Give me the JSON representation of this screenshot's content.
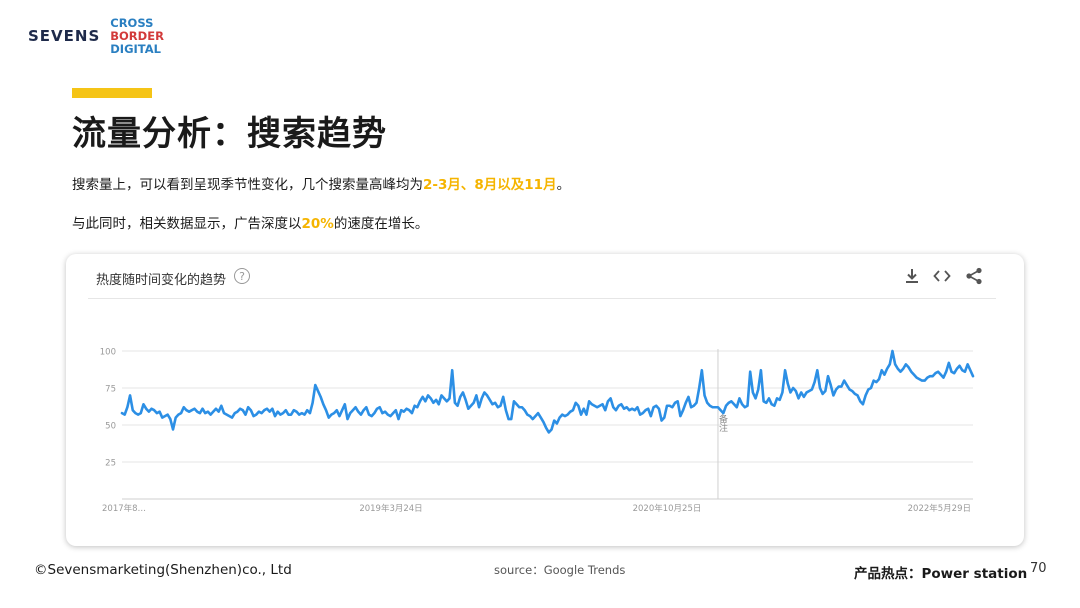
{
  "logo": {
    "brand": "SEVENS",
    "lines": [
      "CROSS",
      "BORDER",
      "DIGITAL"
    ]
  },
  "title": "流量分析：搜索趋势",
  "paragraph1": {
    "before": "搜索量上，可以看到呈现季节性变化，几个搜索量高峰均为",
    "highlight": "2-3月、8月以及11月",
    "after": "。"
  },
  "paragraph2": {
    "before": "与此同时，相关数据显示，广告深度以",
    "highlight": "20%",
    "after": "的速度在增长。"
  },
  "card": {
    "title": "热度随时间变化的趋势",
    "help": "?",
    "tools": [
      "download-icon",
      "embed-icon",
      "share-icon"
    ]
  },
  "footer": {
    "copyright": "©Sevensmarketing(Shenzhen)co., Ltd",
    "source": "source：Google Trends",
    "product": "产品热点：Power station",
    "page": "70"
  },
  "colors": {
    "accent": "#f5c416",
    "highlight": "#f5b400",
    "line": "#2c8fe5"
  },
  "chart_data": {
    "type": "line",
    "title": "",
    "xlabel": "",
    "ylabel": "",
    "ylim": [
      0,
      100
    ],
    "yticks": [
      25,
      50,
      75,
      100
    ],
    "xticks": [
      "2017年8…",
      "2019年3月24日",
      "2020年10月25日",
      "2022年5月29日"
    ],
    "annotation": "备注",
    "annotation_index": 222,
    "grid": true,
    "series": [
      {
        "values": [
          58,
          57,
          62,
          70,
          60,
          58,
          57,
          58,
          64,
          61,
          59,
          61,
          60,
          58,
          59,
          55,
          56,
          57,
          54,
          47,
          55,
          57,
          58,
          62,
          60,
          59,
          60,
          61,
          59,
          58,
          61,
          58,
          59,
          57,
          59,
          61,
          59,
          63,
          58,
          57,
          56,
          55,
          58,
          59,
          61,
          60,
          57,
          62,
          60,
          56,
          57,
          59,
          58,
          60,
          61,
          59,
          61,
          56,
          59,
          57,
          58,
          60,
          57,
          57,
          60,
          59,
          57,
          58,
          57,
          60,
          58,
          65,
          77,
          73,
          69,
          64,
          60,
          55,
          57,
          58,
          60,
          56,
          60,
          64,
          54,
          58,
          60,
          62,
          59,
          57,
          60,
          62,
          57,
          56,
          58,
          61,
          62,
          58,
          59,
          57,
          56,
          58,
          60,
          54,
          60,
          59,
          61,
          60,
          58,
          63,
          62,
          66,
          69,
          66,
          70,
          68,
          65,
          67,
          64,
          70,
          68,
          66,
          68,
          87,
          65,
          63,
          69,
          72,
          67,
          61,
          63,
          65,
          70,
          62,
          68,
          72,
          70,
          67,
          64,
          65,
          62,
          63,
          69,
          60,
          54,
          54,
          66,
          64,
          62,
          62,
          60,
          57,
          56,
          54,
          56,
          58,
          55,
          52,
          48,
          45,
          47,
          53,
          51,
          55,
          57,
          56,
          57,
          59,
          60,
          65,
          63,
          57,
          61,
          57,
          66,
          64,
          63,
          62,
          63,
          64,
          60,
          66,
          68,
          62,
          60,
          63,
          64,
          61,
          62,
          60,
          61,
          60,
          62,
          57,
          58,
          60,
          61,
          56,
          62,
          63,
          61,
          53,
          55,
          63,
          63,
          62,
          65,
          66,
          56,
          60,
          65,
          69,
          62,
          63,
          65,
          75,
          87,
          70,
          65,
          63,
          62,
          62,
          62,
          60,
          58,
          63,
          65,
          66,
          64,
          62,
          68,
          64,
          62,
          63,
          86,
          72,
          68,
          74,
          87,
          66,
          65,
          68,
          64,
          63,
          68,
          67,
          72,
          87,
          78,
          72,
          75,
          73,
          68,
          72,
          69,
          72,
          73,
          74,
          79,
          87,
          75,
          71,
          73,
          83,
          77,
          70,
          74,
          76,
          76,
          80,
          77,
          74,
          73,
          71,
          70,
          66,
          64,
          70,
          74,
          75,
          80,
          79,
          81,
          87,
          84,
          88,
          91,
          100,
          91,
          88,
          86,
          88,
          91,
          89,
          86,
          84,
          82,
          81,
          80,
          80,
          82,
          83,
          83,
          85,
          86,
          84,
          82,
          86,
          92,
          86,
          85,
          88,
          90,
          87,
          86,
          91,
          87,
          83
        ]
      }
    ]
  }
}
